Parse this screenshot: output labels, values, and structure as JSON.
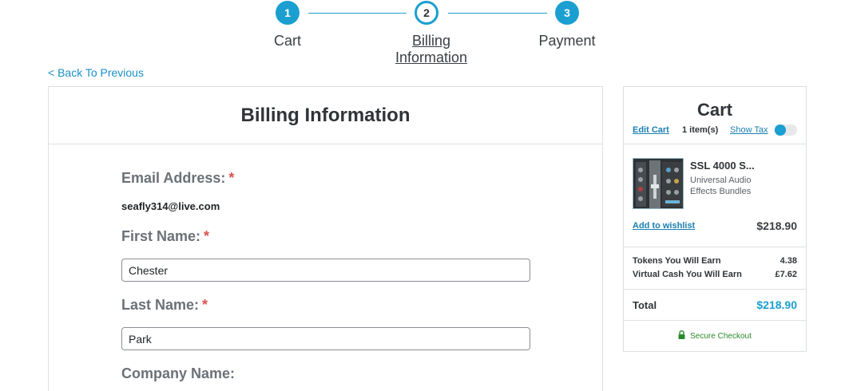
{
  "stepper": {
    "steps": [
      {
        "number": "1",
        "label": "Cart",
        "state": "done"
      },
      {
        "number": "2",
        "label_line1": "Billing",
        "label_line2": "Information",
        "state": "active"
      },
      {
        "number": "3",
        "label": "Payment",
        "state": "done"
      }
    ]
  },
  "nav": {
    "back_label": "< Back To Previous"
  },
  "billing": {
    "title": "Billing Information",
    "email_label": "Email Address:",
    "email_value": "seafly314@live.com",
    "first_name_label": "First Name:",
    "first_name_value": "Chester",
    "last_name_label": "Last Name:",
    "last_name_value": "Park",
    "company_label": "Company Name:",
    "required_mark": "*"
  },
  "cart": {
    "title": "Cart",
    "edit_label": "Edit Cart",
    "item_count": "1 item(s)",
    "show_tax_label": "Show Tax",
    "show_tax_on": false,
    "item": {
      "name": "SSL 4000 S...",
      "subtitle_line1": "Universal Audio",
      "subtitle_line2": "Effects Bundles",
      "price": "$218.90",
      "wishlist_label": "Add to wishlist"
    },
    "tokens_label": "Tokens You Will Earn",
    "tokens_value": "4.38",
    "cash_label": "Virtual Cash You Will Earn",
    "cash_value": "£7.62",
    "total_label": "Total",
    "total_value": "$218.90",
    "secure_label": "Secure Checkout"
  },
  "colors": {
    "accent": "#1a9fd0",
    "link": "#1a7fb0",
    "required": "#d9534f",
    "secure": "#2a8a2a"
  },
  "icons": [
    "lock-icon",
    "product-thumbnail"
  ]
}
